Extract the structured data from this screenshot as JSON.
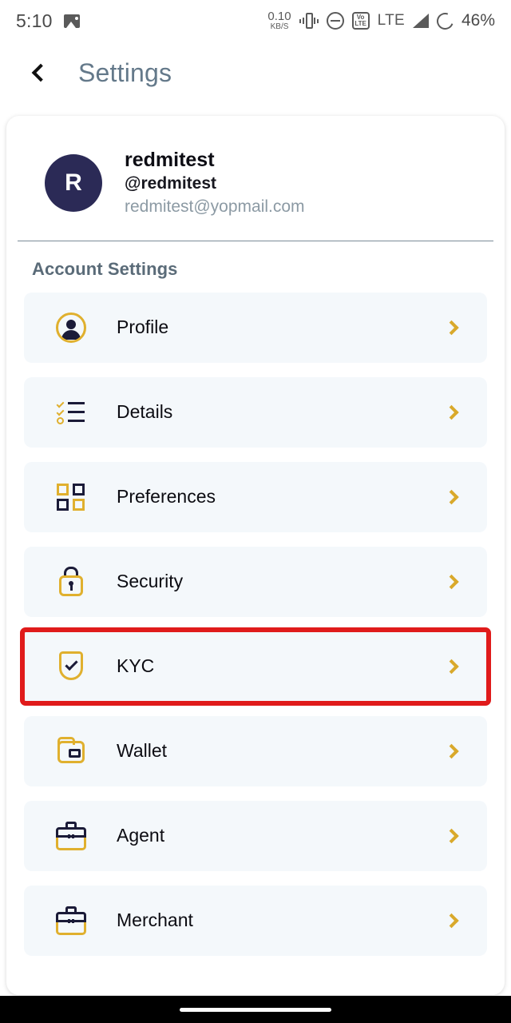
{
  "status_bar": {
    "time": "5:10",
    "gallery_icon": "image-icon",
    "data_rate_value": "0.10",
    "data_rate_unit": "KB/S",
    "vibrate_icon": "vibrate-icon",
    "dnd_icon": "do-not-disturb-icon",
    "volte_line1": "Vo",
    "volte_line2": "LTE",
    "network_type": "LTE",
    "signal_icon": "signal-bars-icon",
    "battery_icon": "battery-circle-icon",
    "battery_percent": "46%"
  },
  "header": {
    "back_icon": "chevron-left-icon",
    "title": "Settings",
    "title_color": "#64798a"
  },
  "profile": {
    "avatar_initial": "R",
    "avatar_color": "#2b2a56",
    "name": "redmitest",
    "handle": "@redmitest",
    "email": "redmitest@yopmail.com"
  },
  "section": {
    "title": "Account Settings"
  },
  "theme": {
    "gold": "#e0b02e",
    "navy": "#1b1b38",
    "row_bg": "#f4f8fb",
    "highlight": "#e01b1b",
    "chevron": "#d9a92b"
  },
  "rows": [
    {
      "label": "Profile",
      "icon": "user-circle-icon",
      "chevron": "chevron-right-icon",
      "highlighted": false
    },
    {
      "label": "Details",
      "icon": "checklist-icon",
      "chevron": "chevron-right-icon",
      "highlighted": false
    },
    {
      "label": "Preferences",
      "icon": "grid-squares-icon",
      "chevron": "chevron-right-icon",
      "highlighted": false
    },
    {
      "label": "Security",
      "icon": "padlock-icon",
      "chevron": "chevron-right-icon",
      "highlighted": false
    },
    {
      "label": "KYC",
      "icon": "shield-check-icon",
      "chevron": "chevron-right-icon",
      "highlighted": true
    },
    {
      "label": "Wallet",
      "icon": "wallet-icon",
      "chevron": "chevron-right-icon",
      "highlighted": false
    },
    {
      "label": "Agent",
      "icon": "briefcase-icon",
      "chevron": "chevron-right-icon",
      "highlighted": false
    },
    {
      "label": "Merchant",
      "icon": "briefcase-icon",
      "chevron": "chevron-right-icon",
      "highlighted": false
    }
  ],
  "nav_bar": {
    "home_indicator": "home-indicator"
  }
}
